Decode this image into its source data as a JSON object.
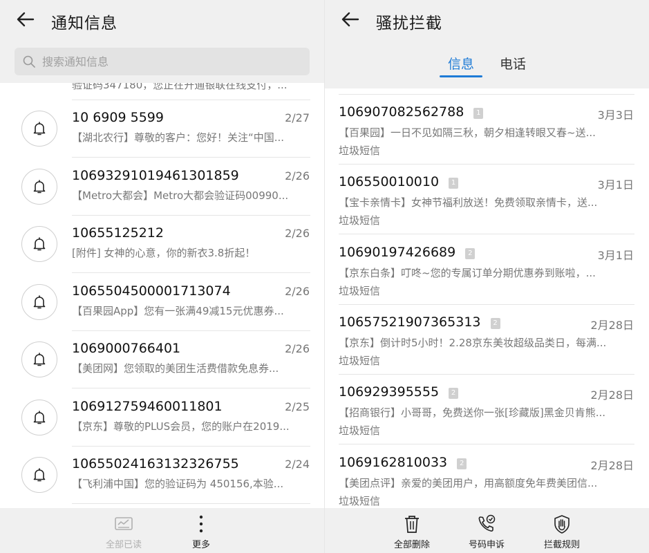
{
  "left": {
    "title": "通知信息",
    "search_placeholder": "搜索通知信息",
    "partial_text": "验证码347180，您正在开通银联在线支付，...",
    "items": [
      {
        "number": "10 6909 5599",
        "date": "2/27",
        "preview": "【湖北农行】尊敬的客户：您好！关注“中国..."
      },
      {
        "number": "1069329101946130185​9",
        "date": "2/26",
        "preview": "【Metro大都会】Metro大都会验证码00990..."
      },
      {
        "number": "10655125212",
        "date": "2/26",
        "preview": "[附件] 女神的心意，你的新衣3.8折起！"
      },
      {
        "number": "1065504500001713074",
        "date": "2/26",
        "preview": "【百果园App】您有一张满49减15元优惠券..."
      },
      {
        "number": "1069000766401",
        "date": "2/26",
        "preview": "【美团网】您领取的美团生活费借款免息券..."
      },
      {
        "number": "106912759460011801",
        "date": "2/25",
        "preview": "【京东】尊敬的PLUS会员，您的账户在2019..."
      },
      {
        "number": "10655024163132326755",
        "date": "2/24",
        "preview": "【飞利浦中国】您的验证码为 450156,本验..."
      }
    ],
    "footer": {
      "mark_all_read": "全部已读",
      "more": "更多"
    }
  },
  "right": {
    "title": "骚扰拦截",
    "tabs": [
      "信息",
      "电话"
    ],
    "items": [
      {
        "number": "106907082562788",
        "sim": "1",
        "date": "3月3日",
        "preview": "【百果园】一日不见如隔三秋，朝夕相逢转眼又春~送...",
        "tag": "垃圾短信"
      },
      {
        "number": "106550010010",
        "sim": "1",
        "date": "3月1日",
        "preview": "【宝卡亲情卡】女神节福利放送！免费领取亲情卡，送...",
        "tag": "垃圾短信"
      },
      {
        "number": "10690197426689",
        "sim": "2",
        "date": "3月1日",
        "preview": "【京东白条】叮咚~您的专属订单分期优惠券到账啦，...",
        "tag": "垃圾短信"
      },
      {
        "number": "10657521907365313",
        "sim": "2",
        "date": "2月28日",
        "preview": "【京东】倒计时5小时！2.28京东美妆超级品类日，每满...",
        "tag": "垃圾短信"
      },
      {
        "number": "106929395555",
        "sim": "2",
        "date": "2月28日",
        "preview": "【招商银行】小哥哥，免费送你一张[珍藏版]黑金贝肯熊...",
        "tag": "垃圾短信"
      },
      {
        "number": "1069162810033",
        "sim": "2",
        "date": "2月28日",
        "preview": "【美团点评】亲爱的美团用户，用高额度免年费美团信...",
        "tag": "垃圾短信"
      }
    ],
    "footer": {
      "delete_all": "全部删除",
      "appeal": "号码申诉",
      "rules": "拦截规则"
    }
  }
}
